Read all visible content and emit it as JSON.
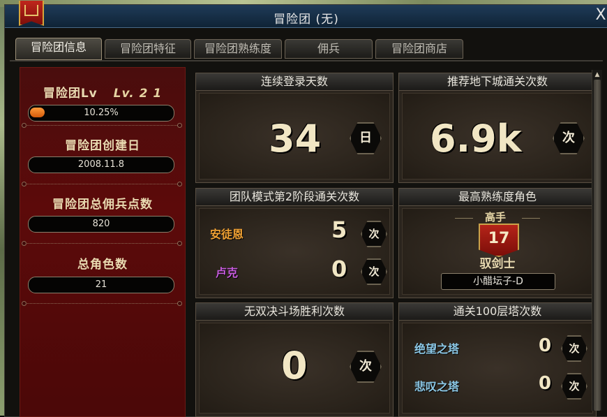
{
  "window": {
    "title": "冒险团 (无)",
    "close_glyph": "X"
  },
  "tabs": [
    {
      "label": "冒险团信息",
      "active": true
    },
    {
      "label": "冒险团特征",
      "active": false
    },
    {
      "label": "冒险团熟练度",
      "active": false
    },
    {
      "label": "佣兵",
      "active": false
    },
    {
      "label": "冒险团商店",
      "active": false
    }
  ],
  "sidebar": {
    "level_label": "冒险团Lv",
    "level_value": "Lv. 2 1",
    "exp_percent": "10.25%",
    "exp_fraction": 0.1025,
    "created_label": "冒险团创建日",
    "created_value": "2008.11.8",
    "mercenary_label": "冒险团总佣兵点数",
    "mercenary_value": "820",
    "characters_label": "总角色数",
    "characters_value": "21"
  },
  "panels": {
    "login": {
      "title": "连续登录天数",
      "value": "34",
      "unit": "日"
    },
    "dungeon": {
      "title": "推荐地下城通关次数",
      "value": "6.9k",
      "unit": "次"
    },
    "team": {
      "title": "团队模式第2阶段通关次数",
      "rows": [
        {
          "name": "安徒恩",
          "value": "5",
          "unit": "次",
          "color": "#f0a133"
        },
        {
          "name": "卢克",
          "value": "0",
          "unit": "次",
          "color": "#c65bdc"
        }
      ]
    },
    "top_char": {
      "title": "最高熟练度角色",
      "rank": "高手",
      "level": "17",
      "job": "驭剑士",
      "character": "小醋坛子-D"
    },
    "arena": {
      "title": "无双决斗场胜利次数",
      "value": "0",
      "unit": "次"
    },
    "tower": {
      "title": "通关100层塔次数",
      "rows": [
        {
          "name": "绝望之塔",
          "value": "0",
          "unit": "次",
          "color": "#8cc8e6"
        },
        {
          "name": "悲叹之塔",
          "value": "0",
          "unit": "次",
          "color": "#8cc8e6"
        }
      ]
    }
  },
  "colors": {
    "accent_gold": "#f1e6c4",
    "sidebar_red": "#5c0a0a",
    "progress_orange": "#ff9a3a",
    "titlebar_blue": "#1f3b58"
  }
}
